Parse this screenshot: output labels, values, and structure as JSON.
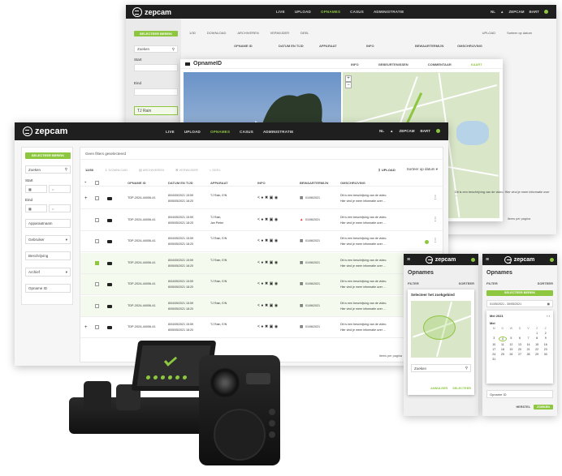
{
  "brand": {
    "name": "zepcam",
    "accent": "#8dc63f",
    "dark": "#1f1f1f"
  },
  "nav": [
    "LIVE",
    "UPLOAD",
    "OPNAMES",
    "CASUS",
    "ADMINISTRATIE"
  ],
  "nav_active": "OPNAMES",
  "user": {
    "lang": "NL",
    "name": "ZEPCAM",
    "menu": "BART"
  },
  "back_window": {
    "side_button": "SELECTEER BEREIK",
    "search": "Zoeken",
    "start_label": "Start",
    "end_label": "Eind",
    "selected_item": "TJ Rain",
    "toolbar": [
      "DOWNLOAD",
      "ARCHIVEREN",
      "VERWIJDER",
      "DEEL"
    ],
    "upload": "UPLOAD",
    "sort": "Sorteer op datum",
    "columns": [
      "OPNAME ID",
      "DATUM EN TIJD",
      "APPARAAT",
      "INFO",
      "BEWAARTERMIJN",
      "OMSCHRIJVING"
    ]
  },
  "modal": {
    "title": "OpnameID",
    "tabs": [
      "INFO",
      "GEBEURTENISSEN",
      "COMMENTAAR",
      "KAART"
    ],
    "active_tab": "KAART",
    "desc": "Dit is een beschrijving van de video. Hier vind je meer informatie over ...",
    "per_page": "items per pagina"
  },
  "main_window": {
    "side_button": "SELECTEER BEREIK",
    "search": "Zoeken",
    "start_label": "Start",
    "end_label": "Eind",
    "filters": [
      "Apparaatnaam",
      "Gebruiker",
      "Beschrijving",
      "Archief",
      "Opname ID"
    ],
    "no_filters": "Geen filters geselecteerd",
    "count": "12/30",
    "toolbar": [
      "DOWNLOAD",
      "ARCHIVEREN",
      "VERWIJDER",
      "DEEL"
    ],
    "upload": "UPLOAD",
    "sort": "Sorteer op datum",
    "columns": [
      "OPNAME ID",
      "DATUM EN TIJD",
      "APPARAAT",
      "INFO",
      "BEWAARTERMIJN",
      "OMSCHRIJVING"
    ],
    "rows": [
      {
        "id": "TDP-2024-44006-41",
        "date1": "8/04/05/2021 15:59",
        "date2": "8/05/05/2021 18:20",
        "device": "TJ Rain, E/N",
        "device2": "",
        "retention": "01/06/2021",
        "warn": false,
        "desc1": "Dit is een beschrijving van de video.",
        "desc2": "Hier vind je meer informatie over ..."
      },
      {
        "id": "TDP-2024-44006-41",
        "date1": "8/04/05/2021 15:59",
        "date2": "8/05/05/2021 18:20",
        "device": "TJ Rain,",
        "device2": "Jan Pieter",
        "retention": "01/06/2021",
        "warn": true,
        "desc1": "Dit is een beschrijving van de video.",
        "desc2": "Hier vind je meer informatie over ..."
      },
      {
        "id": "TDP-2024-44006-41",
        "date1": "8/04/05/2021 15:59",
        "date2": "8/05/05/2021 18:20",
        "device": "TJ Rain, E/N",
        "device2": "",
        "retention": "01/06/2021",
        "warn": false,
        "desc1": "Dit is een beschrijving van de video.",
        "desc2": "Hier vind je meer informatie over ..."
      },
      {
        "id": "TDP-2024-44006-41",
        "date1": "8/04/05/2021 15:59",
        "date2": "8/05/05/2021 18:20",
        "device": "TJ Rain, E/N",
        "device2": "",
        "retention": "01/06/2021",
        "warn": false,
        "desc1": "Dit is een beschrijving van de video.",
        "desc2": "Hier vind je meer informatie over ..."
      },
      {
        "id": "TDP-2024-44006-41",
        "date1": "8/04/05/2021 15:59",
        "date2": "8/05/05/2021 18:20",
        "device": "TJ Rain, E/N",
        "device2": "",
        "retention": "01/06/2021",
        "warn": false,
        "desc1": "Dit is een beschrijving van de video.",
        "desc2": "Hier vind je meer informatie over ..."
      },
      {
        "id": "TDP-2024-44006-41",
        "date1": "8/04/05/2021 15:59",
        "date2": "8/05/05/2021 18:20",
        "device": "TJ Rain, E/N",
        "device2": "",
        "retention": "01/06/2021",
        "warn": false,
        "desc1": "Dit is een beschrijving van de video.",
        "desc2": "Hier vind je meer informatie over ..."
      },
      {
        "id": "TDP-2024-44006-41",
        "date1": "8/04/05/2021 15:59",
        "date2": "8/05/05/2021 18:20",
        "device": "TJ Rain, E/N",
        "device2": "",
        "retention": "01/06/2021",
        "warn": false,
        "desc1": "Dit is een beschrijving van de video.",
        "desc2": "Hier vind je meer informatie over ..."
      }
    ],
    "per_page": "items per pagina"
  },
  "mobile1": {
    "title": "Opnames",
    "filter": "FILTER",
    "sort": "SORTEER",
    "modal_title": "Selecteer het zoekgebied",
    "search": "Zoeken",
    "cancel": "ANNULEER",
    "confirm": "SELECTEER"
  },
  "mobile2": {
    "title": "Opnames",
    "filter": "FILTER",
    "sort": "SORTEER",
    "range_button": "SELECTEER BEREIK",
    "range_value": "01/05/2021 - 30/05/2021",
    "month_label": "Mei 2021",
    "month_short": "Mei",
    "weekdays": [
      "M",
      "D",
      "W",
      "D",
      "V",
      "Z",
      "Z"
    ],
    "days": [
      "1",
      "2",
      "3",
      "4",
      "5",
      "6",
      "7",
      "8",
      "9",
      "10",
      "11",
      "12",
      "13",
      "14",
      "15",
      "16",
      "17",
      "18",
      "19",
      "20",
      "21",
      "22",
      "23",
      "24",
      "25",
      "26",
      "27",
      "28",
      "29",
      "30",
      "31"
    ],
    "field": "Opname ID",
    "reset": "HERSTEL",
    "apply": "ZOEKEN"
  }
}
